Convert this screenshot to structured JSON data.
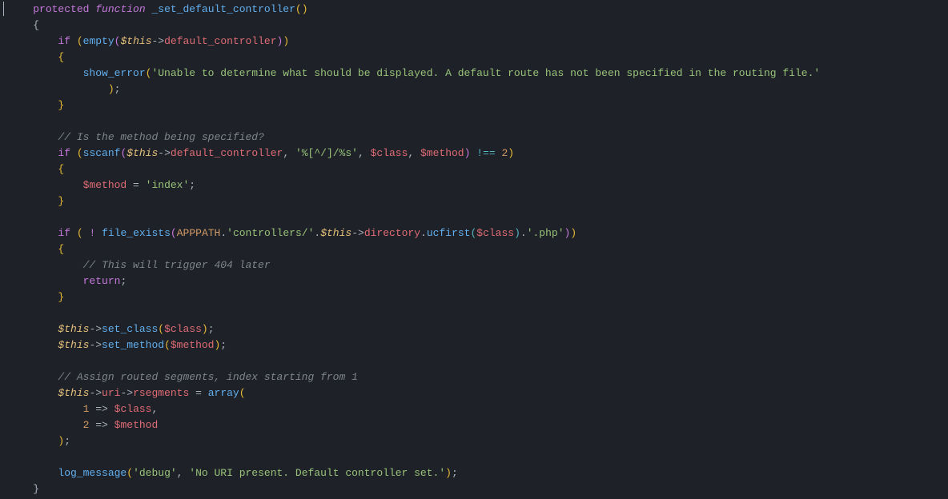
{
  "lines": {
    "l1": {
      "ind": "    ",
      "kw_protected": "protected",
      "kw_function": "function",
      "name": "_set_default_controller"
    },
    "l2": {
      "ind": "    ",
      "brace": "{"
    },
    "l3": {
      "ind": "        ",
      "kw_if": "if",
      "fn": "empty",
      "this": "$this",
      "arrow": "->",
      "prop": "default_controller"
    },
    "l4": {
      "ind": "        ",
      "brace": "{"
    },
    "l5": {
      "ind": "            ",
      "fn": "show_error",
      "str": "'Unable to determine what should be displayed. A default route has not been specified in the routing file.'"
    },
    "l5b": {
      "ind": "                ",
      "tail": ");"
    },
    "l6": {
      "ind": "        ",
      "brace": "}"
    },
    "l7": {
      "ind": ""
    },
    "l8": {
      "ind": "        ",
      "comment": "// Is the method being specified?"
    },
    "l9": {
      "ind": "        ",
      "kw_if": "if",
      "fn": "sscanf",
      "this": "$this",
      "arrow": "->",
      "prop": "default_controller",
      "str": "'%[^/]/%s'",
      "v1": "$class",
      "v2": "$method",
      "op": "!==",
      "num": "2"
    },
    "l10": {
      "ind": "        ",
      "brace": "{"
    },
    "l11": {
      "ind": "            ",
      "var": "$method",
      "eq": "=",
      "str": "'index'",
      "semi": ";"
    },
    "l12": {
      "ind": "        ",
      "brace": "}"
    },
    "l13": {
      "ind": ""
    },
    "l14": {
      "ind": "        ",
      "kw_if": "if",
      "bang": "!",
      "fn": "file_exists",
      "const": "APPPATH",
      "s1": "'controllers/'",
      "this": "$this",
      "arrow": "->",
      "prop": "directory",
      "fn2": "ucfirst",
      "v": "$class",
      "s2": "'.php'"
    },
    "l15": {
      "ind": "        ",
      "brace": "{"
    },
    "l16": {
      "ind": "            ",
      "comment": "// This will trigger 404 later"
    },
    "l17": {
      "ind": "            ",
      "kw": "return",
      "semi": ";"
    },
    "l18": {
      "ind": "        ",
      "brace": "}"
    },
    "l19": {
      "ind": ""
    },
    "l20": {
      "ind": "        ",
      "this": "$this",
      "arrow": "->",
      "fn": "set_class",
      "v": "$class"
    },
    "l21": {
      "ind": "        ",
      "this": "$this",
      "arrow": "->",
      "fn": "set_method",
      "v": "$method"
    },
    "l22": {
      "ind": ""
    },
    "l23": {
      "ind": "        ",
      "comment": "// Assign routed segments, index starting from 1"
    },
    "l24": {
      "ind": "        ",
      "this": "$this",
      "arrow": "->",
      "p1": "uri",
      "p2": "rsegments",
      "eq": "=",
      "fn": "array"
    },
    "l25": {
      "ind": "            ",
      "k": "1",
      "arw": "=>",
      "v": "$class",
      "comma": ","
    },
    "l26": {
      "ind": "            ",
      "k": "2",
      "arw": "=>",
      "v": "$method"
    },
    "l27": {
      "ind": "        ",
      "close": ");"
    },
    "l28": {
      "ind": ""
    },
    "l29": {
      "ind": "        ",
      "fn": "log_message",
      "s1": "'debug'",
      "s2": "'No URI present. Default controller set.'"
    },
    "l30": {
      "ind": "    ",
      "brace": "}"
    }
  }
}
